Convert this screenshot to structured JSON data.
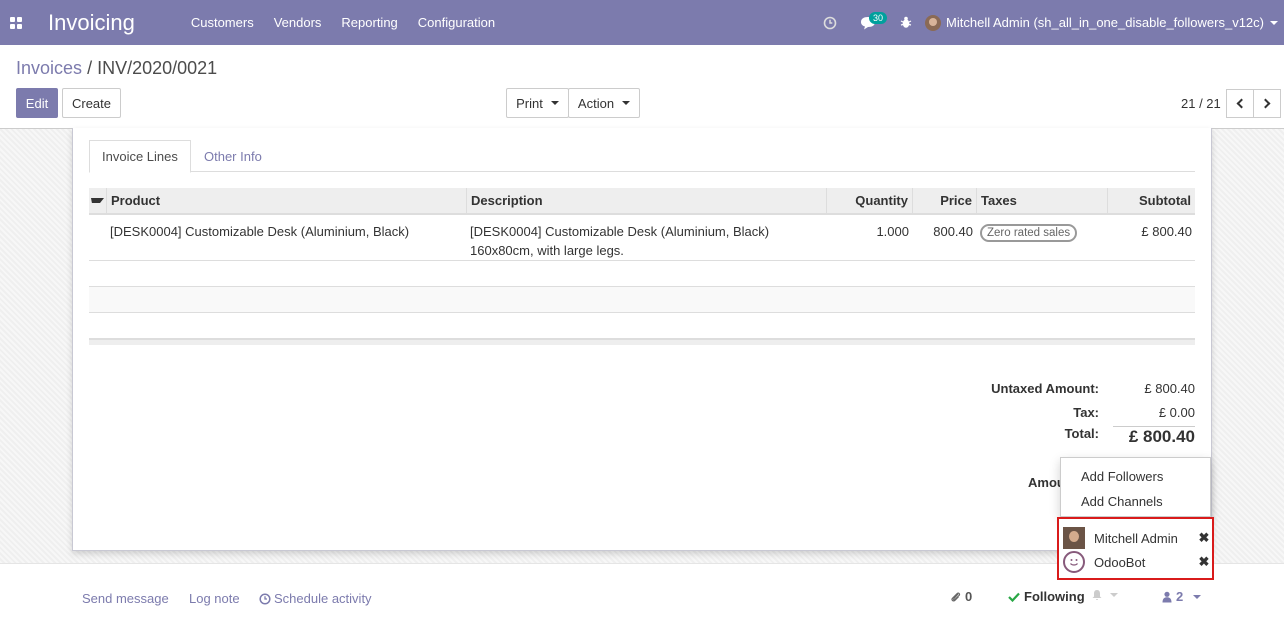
{
  "navbar": {
    "app_title": "Invoicing",
    "menu": [
      "Customers",
      "Vendors",
      "Reporting",
      "Configuration"
    ],
    "messages_count": "30",
    "user_name": "Mitchell Admin (sh_all_in_one_disable_followers_v12c)"
  },
  "control": {
    "breadcrumb_parent": "Invoices",
    "breadcrumb_separator": "/",
    "breadcrumb_current": "INV/2020/0021",
    "edit_label": "Edit",
    "create_label": "Create",
    "print_label": "Print",
    "action_label": "Action",
    "pager": "21 / 21"
  },
  "tabs": {
    "invoice_lines": "Invoice Lines",
    "other_info": "Other Info"
  },
  "lines": {
    "headers": {
      "product": "Product",
      "description": "Description",
      "quantity": "Quantity",
      "price": "Price",
      "taxes": "Taxes",
      "subtotal": "Subtotal"
    },
    "rows": [
      {
        "product": "[DESK0004] Customizable Desk (Aluminium, Black)",
        "description_1": "[DESK0004] Customizable Desk (Aluminium, Black)",
        "description_2": "160x80cm, with large legs.",
        "quantity": "1.000",
        "price": "800.40",
        "tax": "Zero rated sales",
        "subtotal": "£ 800.40"
      }
    ]
  },
  "totals": {
    "untaxed_label": "Untaxed Amount:",
    "untaxed_value": "£ 800.40",
    "tax_label": "Tax:",
    "tax_value": "£ 0.00",
    "total_label": "Total:",
    "total_value": "£ 800.40",
    "amount_due_partial": "Amou"
  },
  "followers_menu": {
    "add_followers": "Add Followers",
    "add_channels": "Add Channels",
    "followers": [
      {
        "name": "Mitchell Admin"
      },
      {
        "name": "OdooBot"
      }
    ]
  },
  "chatter": {
    "send_message": "Send message",
    "log_note": "Log note",
    "schedule_activity": "Schedule activity",
    "attachments_count": "0",
    "following_label": "Following",
    "followers_count": "2"
  },
  "colors": {
    "brand": "#7c7bad",
    "badge": "#00a09d",
    "highlight_border": "#d91b1b"
  }
}
